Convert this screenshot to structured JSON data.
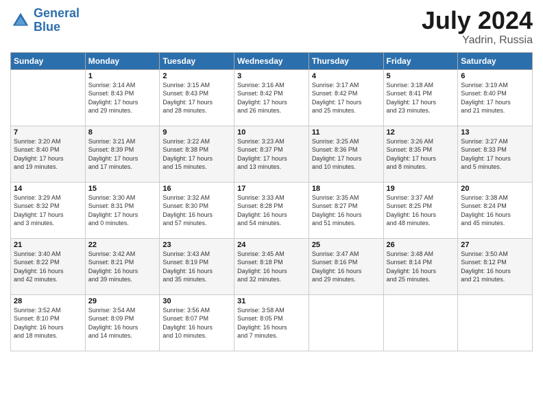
{
  "header": {
    "logo_line1": "General",
    "logo_line2": "Blue",
    "month": "July 2024",
    "location": "Yadrin, Russia"
  },
  "weekdays": [
    "Sunday",
    "Monday",
    "Tuesday",
    "Wednesday",
    "Thursday",
    "Friday",
    "Saturday"
  ],
  "weeks": [
    [
      {
        "day": "",
        "info": ""
      },
      {
        "day": "1",
        "info": "Sunrise: 3:14 AM\nSunset: 8:43 PM\nDaylight: 17 hours\nand 29 minutes."
      },
      {
        "day": "2",
        "info": "Sunrise: 3:15 AM\nSunset: 8:43 PM\nDaylight: 17 hours\nand 28 minutes."
      },
      {
        "day": "3",
        "info": "Sunrise: 3:16 AM\nSunset: 8:42 PM\nDaylight: 17 hours\nand 26 minutes."
      },
      {
        "day": "4",
        "info": "Sunrise: 3:17 AM\nSunset: 8:42 PM\nDaylight: 17 hours\nand 25 minutes."
      },
      {
        "day": "5",
        "info": "Sunrise: 3:18 AM\nSunset: 8:41 PM\nDaylight: 17 hours\nand 23 minutes."
      },
      {
        "day": "6",
        "info": "Sunrise: 3:19 AM\nSunset: 8:40 PM\nDaylight: 17 hours\nand 21 minutes."
      }
    ],
    [
      {
        "day": "7",
        "info": "Sunrise: 3:20 AM\nSunset: 8:40 PM\nDaylight: 17 hours\nand 19 minutes."
      },
      {
        "day": "8",
        "info": "Sunrise: 3:21 AM\nSunset: 8:39 PM\nDaylight: 17 hours\nand 17 minutes."
      },
      {
        "day": "9",
        "info": "Sunrise: 3:22 AM\nSunset: 8:38 PM\nDaylight: 17 hours\nand 15 minutes."
      },
      {
        "day": "10",
        "info": "Sunrise: 3:23 AM\nSunset: 8:37 PM\nDaylight: 17 hours\nand 13 minutes."
      },
      {
        "day": "11",
        "info": "Sunrise: 3:25 AM\nSunset: 8:36 PM\nDaylight: 17 hours\nand 10 minutes."
      },
      {
        "day": "12",
        "info": "Sunrise: 3:26 AM\nSunset: 8:35 PM\nDaylight: 17 hours\nand 8 minutes."
      },
      {
        "day": "13",
        "info": "Sunrise: 3:27 AM\nSunset: 8:33 PM\nDaylight: 17 hours\nand 5 minutes."
      }
    ],
    [
      {
        "day": "14",
        "info": "Sunrise: 3:29 AM\nSunset: 8:32 PM\nDaylight: 17 hours\nand 3 minutes."
      },
      {
        "day": "15",
        "info": "Sunrise: 3:30 AM\nSunset: 8:31 PM\nDaylight: 17 hours\nand 0 minutes."
      },
      {
        "day": "16",
        "info": "Sunrise: 3:32 AM\nSunset: 8:30 PM\nDaylight: 16 hours\nand 57 minutes."
      },
      {
        "day": "17",
        "info": "Sunrise: 3:33 AM\nSunset: 8:28 PM\nDaylight: 16 hours\nand 54 minutes."
      },
      {
        "day": "18",
        "info": "Sunrise: 3:35 AM\nSunset: 8:27 PM\nDaylight: 16 hours\nand 51 minutes."
      },
      {
        "day": "19",
        "info": "Sunrise: 3:37 AM\nSunset: 8:25 PM\nDaylight: 16 hours\nand 48 minutes."
      },
      {
        "day": "20",
        "info": "Sunrise: 3:38 AM\nSunset: 8:24 PM\nDaylight: 16 hours\nand 45 minutes."
      }
    ],
    [
      {
        "day": "21",
        "info": "Sunrise: 3:40 AM\nSunset: 8:22 PM\nDaylight: 16 hours\nand 42 minutes."
      },
      {
        "day": "22",
        "info": "Sunrise: 3:42 AM\nSunset: 8:21 PM\nDaylight: 16 hours\nand 39 minutes."
      },
      {
        "day": "23",
        "info": "Sunrise: 3:43 AM\nSunset: 8:19 PM\nDaylight: 16 hours\nand 35 minutes."
      },
      {
        "day": "24",
        "info": "Sunrise: 3:45 AM\nSunset: 8:18 PM\nDaylight: 16 hours\nand 32 minutes."
      },
      {
        "day": "25",
        "info": "Sunrise: 3:47 AM\nSunset: 8:16 PM\nDaylight: 16 hours\nand 29 minutes."
      },
      {
        "day": "26",
        "info": "Sunrise: 3:48 AM\nSunset: 8:14 PM\nDaylight: 16 hours\nand 25 minutes."
      },
      {
        "day": "27",
        "info": "Sunrise: 3:50 AM\nSunset: 8:12 PM\nDaylight: 16 hours\nand 21 minutes."
      }
    ],
    [
      {
        "day": "28",
        "info": "Sunrise: 3:52 AM\nSunset: 8:10 PM\nDaylight: 16 hours\nand 18 minutes."
      },
      {
        "day": "29",
        "info": "Sunrise: 3:54 AM\nSunset: 8:09 PM\nDaylight: 16 hours\nand 14 minutes."
      },
      {
        "day": "30",
        "info": "Sunrise: 3:56 AM\nSunset: 8:07 PM\nDaylight: 16 hours\nand 10 minutes."
      },
      {
        "day": "31",
        "info": "Sunrise: 3:58 AM\nSunset: 8:05 PM\nDaylight: 16 hours\nand 7 minutes."
      },
      {
        "day": "",
        "info": ""
      },
      {
        "day": "",
        "info": ""
      },
      {
        "day": "",
        "info": ""
      }
    ]
  ]
}
